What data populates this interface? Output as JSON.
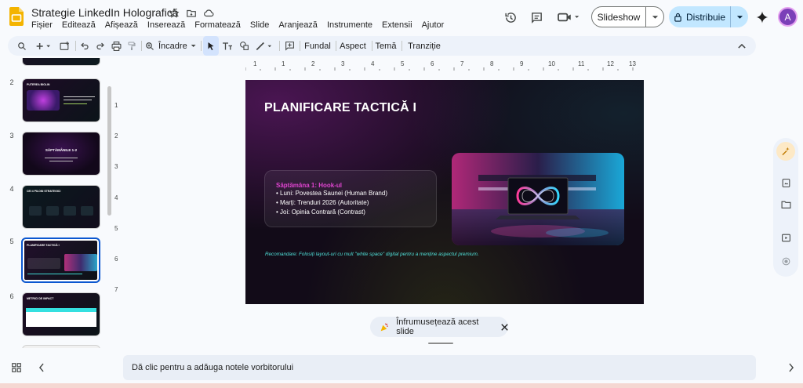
{
  "app": {
    "doc_title": "Strategie LinkedIn Holografică",
    "menu": [
      "Fișier",
      "Editează",
      "Afișează",
      "Inserează",
      "Formatează",
      "Slide",
      "Aranjează",
      "Instrumente",
      "Extensii",
      "Ajutor"
    ],
    "slideshow_label": "Slideshow",
    "share_label": "Distribuie",
    "avatar_letter": "A"
  },
  "toolbar": {
    "zoom_label": "Încadre",
    "fundal": "Fundal",
    "aspect": "Aspect",
    "tema": "Temă",
    "tranzitie": "Tranziție"
  },
  "thumbnails": [
    {
      "num": "",
      "title": ""
    },
    {
      "num": "2",
      "title": "PUTEREA BIOLIN"
    },
    {
      "num": "3",
      "title": "SĂPTĂMÂNILE 1-2"
    },
    {
      "num": "4",
      "title": "CEI 4 PILONI STRATEGICI"
    },
    {
      "num": "5",
      "title": "PLANIFICARE TACTICĂ I"
    },
    {
      "num": "6",
      "title": "METRICI DE IMPACT"
    }
  ],
  "ruler": {
    "h": [
      "1",
      "1",
      "2",
      "3",
      "4",
      "5",
      "6",
      "7",
      "8",
      "9",
      "10",
      "11",
      "12",
      "13"
    ],
    "v": [
      "1",
      "2",
      "3",
      "4",
      "5",
      "6",
      "7"
    ]
  },
  "slide": {
    "title": "PLANIFICARE TACTICĂ I",
    "week_head": "Săptămâna 1: Hook-ul",
    "items": [
      "• Luni: Povestea Saunei (Human Brand)",
      "• Marți: Trenduri 2026 (Autoritate)",
      "• Joi: Opinia Contrară (Contrast)"
    ],
    "recommendation": "Recomandare: Folosiți layout-uri cu mult \"white space\" digital pentru a menține aspectul premium."
  },
  "beautify_label": "Înfrumusețează acest slide",
  "notes_placeholder": "Dă clic pentru a adăuga notele vorbitorului",
  "colors": {
    "accent": "#0b57d0",
    "share_bg": "#c2e7ff",
    "slide_bg": "#120b18",
    "magenta": "#e044d0",
    "cyan": "#4fe0d8"
  }
}
